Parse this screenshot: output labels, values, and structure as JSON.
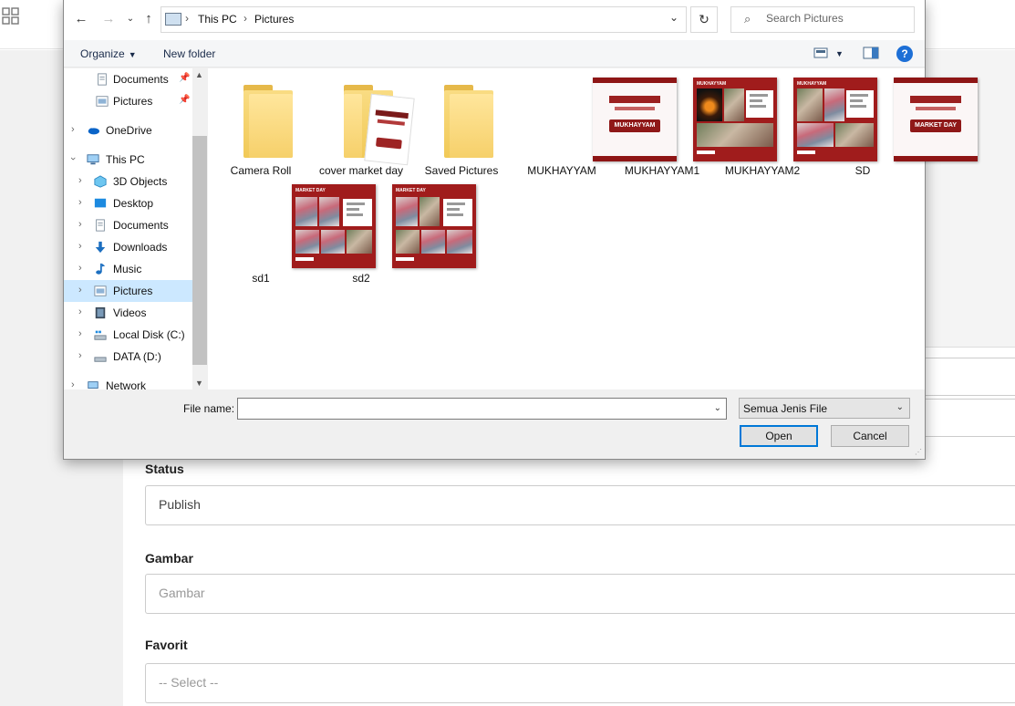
{
  "background_form": {
    "status_label": "Status",
    "status_value": "Publish",
    "gambar_label": "Gambar",
    "gambar_placeholder": "Gambar",
    "favorit_label": "Favorit",
    "favorit_value": "-- Select --"
  },
  "dialog": {
    "address": {
      "segments": [
        "This PC",
        "Pictures"
      ]
    },
    "search_placeholder": "Search Pictures",
    "toolbar": {
      "organize": "Organize",
      "new_folder": "New folder"
    },
    "nav": {
      "quick_access": [
        {
          "label": "Documents",
          "icon": "documents-icon",
          "pinned": true
        },
        {
          "label": "Pictures",
          "icon": "pictures-icon",
          "pinned": true
        }
      ],
      "onedrive": "OneDrive",
      "this_pc": "This PC",
      "this_pc_items": [
        {
          "label": "3D Objects",
          "icon": "3d-objects-icon"
        },
        {
          "label": "Desktop",
          "icon": "desktop-icon"
        },
        {
          "label": "Documents",
          "icon": "documents-icon"
        },
        {
          "label": "Downloads",
          "icon": "downloads-icon"
        },
        {
          "label": "Music",
          "icon": "music-icon"
        },
        {
          "label": "Pictures",
          "icon": "pictures-icon",
          "selected": true
        },
        {
          "label": "Videos",
          "icon": "videos-icon"
        },
        {
          "label": "Local Disk (C:)",
          "icon": "local-disk-icon"
        },
        {
          "label": "DATA (D:)",
          "icon": "drive-icon"
        }
      ],
      "network": "Network"
    },
    "files": [
      {
        "name": "Camera Roll",
        "kind": "folder"
      },
      {
        "name": "cover market day",
        "kind": "folder"
      },
      {
        "name": "Saved Pictures",
        "kind": "folder"
      },
      {
        "name": "MUKHAYYAM",
        "kind": "image",
        "pill": "MUKHAYYAM"
      },
      {
        "name": "MUKHAYYAM1",
        "kind": "image",
        "header": "MUKHAYYAM"
      },
      {
        "name": "MUKHAYYAM2",
        "kind": "image",
        "header": "MUKHAYYAM"
      },
      {
        "name": "SD",
        "kind": "image",
        "pill": "MARKET DAY"
      },
      {
        "name": "sd1",
        "kind": "image",
        "header": "MARKET DAY"
      },
      {
        "name": "sd2",
        "kind": "image",
        "header": "MARKET DAY"
      }
    ],
    "file_name_label": "File name:",
    "file_name_value": "",
    "file_type": "Semua Jenis File",
    "open_label": "Open",
    "cancel_label": "Cancel"
  },
  "colors": {
    "accent": "#0078d7",
    "selection": "#cce8ff",
    "thumb_red": "#a01c1c"
  }
}
